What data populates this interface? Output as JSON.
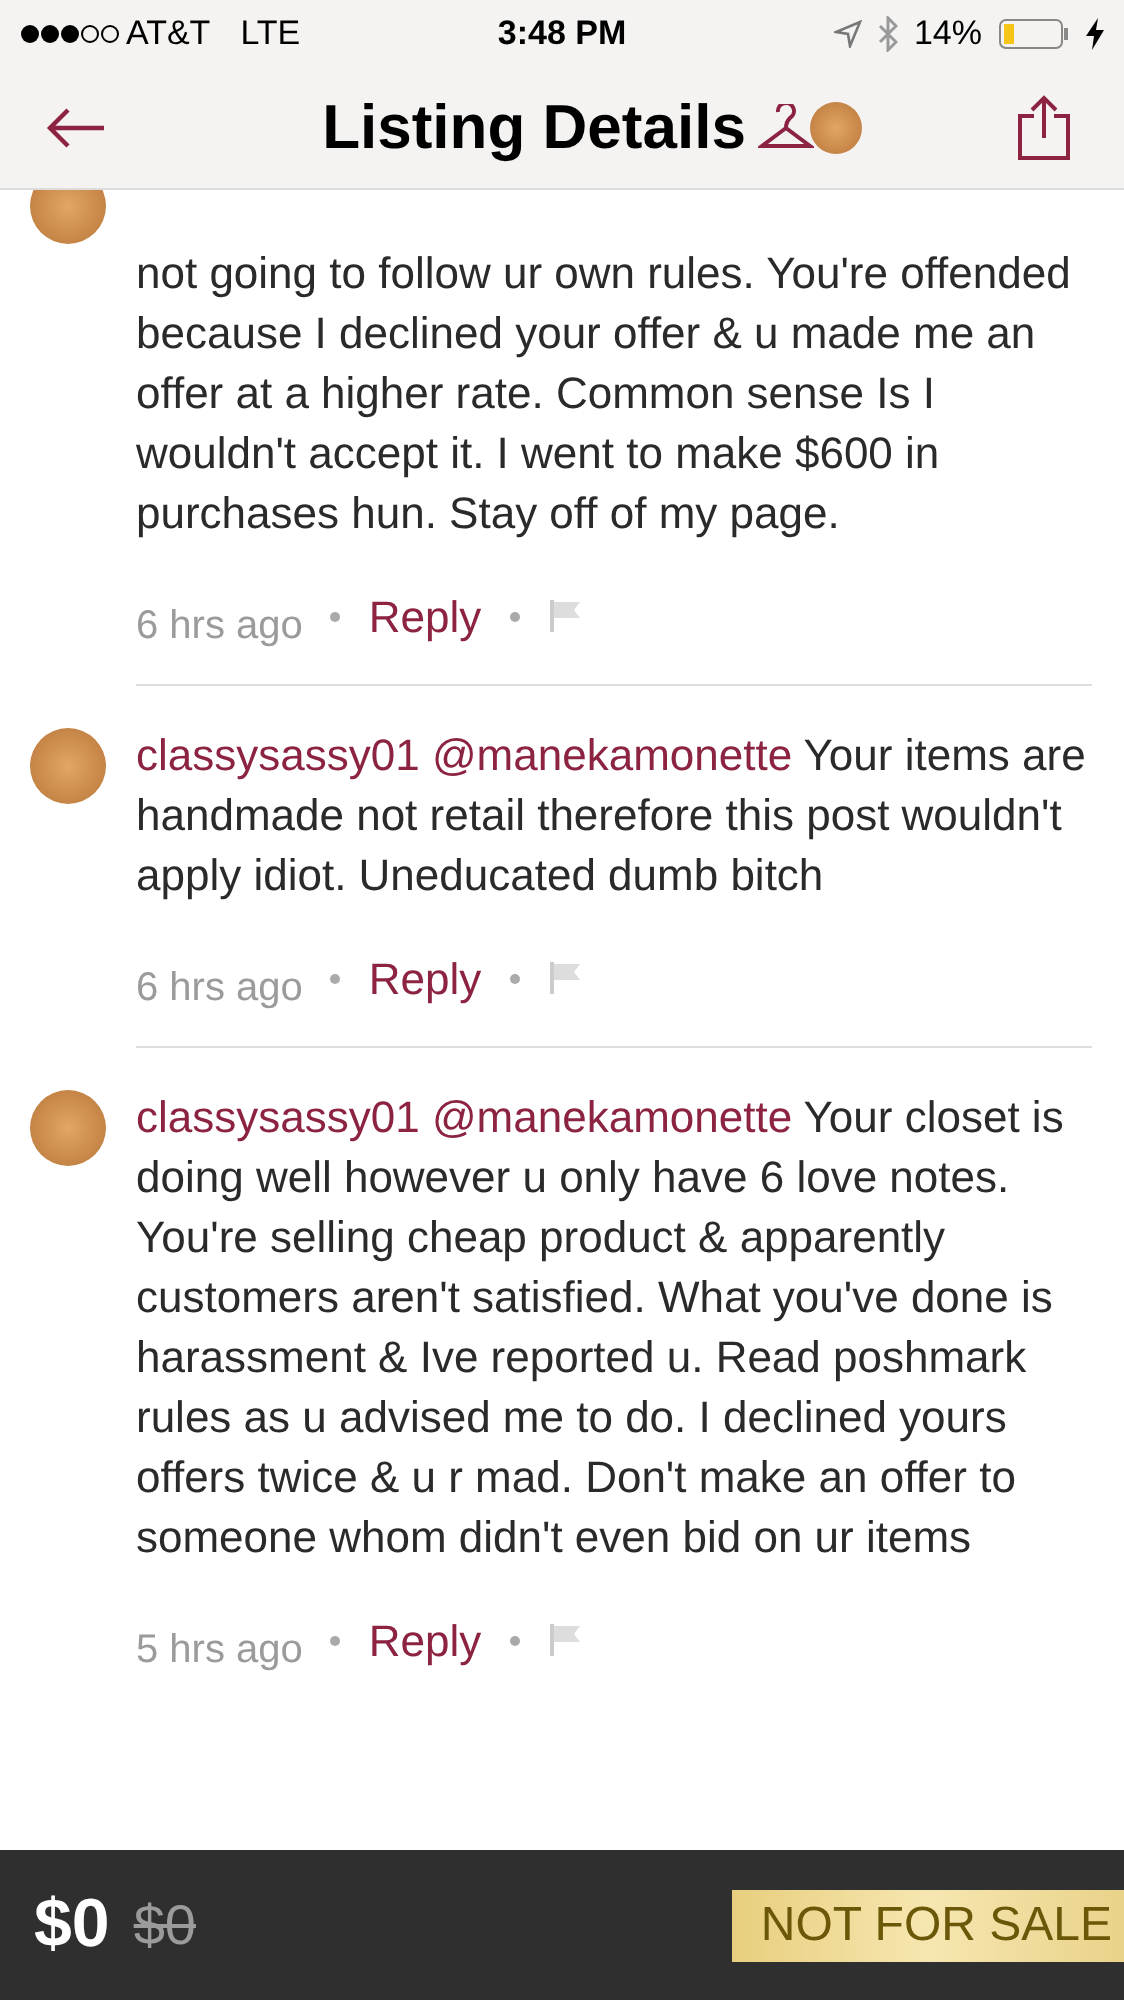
{
  "status_bar": {
    "carrier": "AT&T",
    "network": "LTE",
    "time": "3:48 PM",
    "battery": "14%"
  },
  "header": {
    "title": "Listing Details"
  },
  "comments": [
    {
      "text": "not going to follow ur own rules. You're offended because I declined your offer & u made me an offer at a higher rate. Common sense Is I wouldn't accept it. I went to make $600 in purchases hun. Stay off of my page.",
      "time": "6 hrs ago",
      "reply": "Reply"
    },
    {
      "username": "classysassy01",
      "mention": "@manekamonette",
      "text": "Your items are handmade not retail therefore this post wouldn't apply idiot. Uneducated dumb bitch",
      "time": "6 hrs ago",
      "reply": "Reply"
    },
    {
      "username": "classysassy01",
      "mention": "@manekamonette",
      "text": "Your closet is doing well however u only have 6 love notes. You're selling cheap product & apparently customers aren't satisfied. What you've done is harassment & Ive reported u. Read poshmark rules as u advised me to do. I declined yours offers twice & u r mad. Don't make an offer to someone whom didn't even bid on ur items",
      "time": "5 hrs ago",
      "reply": "Reply"
    }
  ],
  "bottom_bar": {
    "price": "$0",
    "original_price": "$0",
    "badge": "NOT FOR SALE"
  }
}
